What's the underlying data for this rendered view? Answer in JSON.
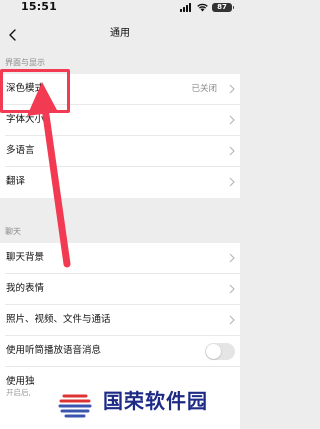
{
  "status_bar": {
    "time": "15:51",
    "battery": "87"
  },
  "nav": {
    "title": "通用"
  },
  "sections": {
    "display": {
      "header": "界面与显示",
      "dark_mode": {
        "label": "深色模式",
        "value": "已关闭"
      },
      "font_size": {
        "label": "字体大小"
      },
      "language": {
        "label": "多语言"
      },
      "translate": {
        "label": "翻译"
      }
    },
    "chat": {
      "header": "聊天",
      "background": {
        "label": "聊天背景"
      },
      "stickers": {
        "label": "我的表情"
      },
      "media": {
        "label": "照片、视频、文件与通话"
      },
      "earpiece": {
        "label": "使用听筒播放语音消息",
        "enabled": false
      },
      "partial": {
        "label": "使用独",
        "sub": "开启后,"
      }
    }
  },
  "watermark": {
    "text": "国荣软件园"
  },
  "colors": {
    "annotation": "#f23a52",
    "watermark_text": "#1d2b86"
  }
}
